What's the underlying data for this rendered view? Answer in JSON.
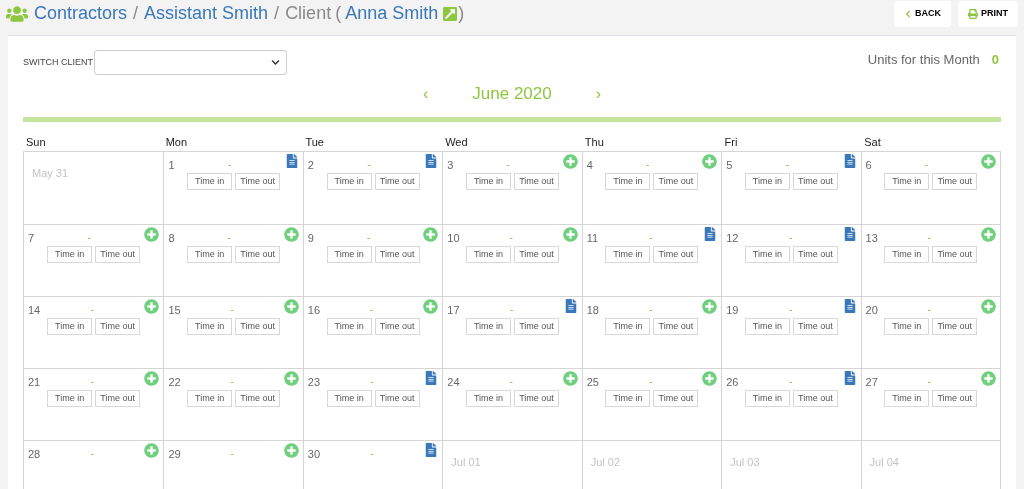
{
  "breadcrumb": [
    {
      "label": "Contractors",
      "kind": "link"
    },
    {
      "label": "/",
      "kind": "sep"
    },
    {
      "label": "Assistant Smith",
      "kind": "link"
    },
    {
      "label": "/",
      "kind": "sep"
    },
    {
      "label": "Client",
      "kind": "muted"
    },
    {
      "label": "(",
      "kind": "muted"
    },
    {
      "label": "Anna Smith",
      "kind": "link"
    },
    {
      "label": ")",
      "kind": "muted"
    }
  ],
  "actions": [
    {
      "label": "BACK",
      "kind": "back"
    },
    {
      "label": "PRINT",
      "kind": "print"
    }
  ],
  "switch_client": {
    "label": "SWITCH CLIENT"
  },
  "units": {
    "label": "Units for this Month",
    "value": "0"
  },
  "month": {
    "prev": "‹",
    "title": "June 2020",
    "next": "›"
  },
  "weekdays": [
    "Sun",
    "Mon",
    "Tue",
    "Wed",
    "Thu",
    "Fri",
    "Sat"
  ],
  "weeks": [
    [
      {
        "date": "May 31",
        "kind": "outside"
      },
      {
        "date": "1",
        "kind": "day_entry",
        "dash": "-",
        "fields": [
          {
            "placeholder": "Time in"
          },
          {
            "placeholder": "Time out"
          }
        ]
      },
      {
        "date": "2",
        "kind": "day_entry",
        "dash": "-",
        "fields": [
          {
            "placeholder": "Time in"
          },
          {
            "placeholder": "Time out"
          }
        ]
      },
      {
        "date": "3",
        "kind": "day_open",
        "dash": "-",
        "fields": [
          {
            "placeholder": "Time in"
          },
          {
            "placeholder": "Time out"
          }
        ]
      },
      {
        "date": "4",
        "kind": "day_open",
        "dash": "-",
        "fields": [
          {
            "placeholder": "Time in"
          },
          {
            "placeholder": "Time out"
          }
        ]
      },
      {
        "date": "5",
        "kind": "day_entry",
        "dash": "-",
        "fields": [
          {
            "placeholder": "Time in"
          },
          {
            "placeholder": "Time out"
          }
        ]
      },
      {
        "date": "6",
        "kind": "day_open",
        "dash": "-",
        "fields": [
          {
            "placeholder": "Time in"
          },
          {
            "placeholder": "Time out"
          }
        ]
      }
    ],
    [
      {
        "date": "7",
        "kind": "day_open",
        "dash": "-",
        "fields": [
          {
            "placeholder": "Time in"
          },
          {
            "placeholder": "Time out"
          }
        ]
      },
      {
        "date": "8",
        "kind": "day_open",
        "dash": "-",
        "fields": [
          {
            "placeholder": "Time in"
          },
          {
            "placeholder": "Time out"
          }
        ]
      },
      {
        "date": "9",
        "kind": "day_open",
        "dash": "-",
        "fields": [
          {
            "placeholder": "Time in"
          },
          {
            "placeholder": "Time out"
          }
        ]
      },
      {
        "date": "10",
        "kind": "day_open",
        "dash": "-",
        "fields": [
          {
            "placeholder": "Time in"
          },
          {
            "placeholder": "Time out"
          }
        ]
      },
      {
        "date": "11",
        "kind": "day_entry",
        "dash": "-",
        "fields": [
          {
            "placeholder": "Time in"
          },
          {
            "placeholder": "Time out"
          }
        ]
      },
      {
        "date": "12",
        "kind": "day_entry",
        "dash": "-",
        "fields": [
          {
            "placeholder": "Time in"
          },
          {
            "placeholder": "Time out"
          }
        ]
      },
      {
        "date": "13",
        "kind": "day_open",
        "dash": "-",
        "fields": [
          {
            "placeholder": "Time in"
          },
          {
            "placeholder": "Time out"
          }
        ]
      }
    ],
    [
      {
        "date": "14",
        "kind": "day_open",
        "dash": "-",
        "fields": [
          {
            "placeholder": "Time in"
          },
          {
            "placeholder": "Time out"
          }
        ]
      },
      {
        "date": "15",
        "kind": "day_open",
        "dash": "-",
        "fields": [
          {
            "placeholder": "Time in"
          },
          {
            "placeholder": "Time out"
          }
        ]
      },
      {
        "date": "16",
        "kind": "day_open",
        "dash": "-",
        "fields": [
          {
            "placeholder": "Time in"
          },
          {
            "placeholder": "Time out"
          }
        ]
      },
      {
        "date": "17",
        "kind": "day_entry",
        "dash": "-",
        "fields": [
          {
            "placeholder": "Time in"
          },
          {
            "placeholder": "Time out"
          }
        ]
      },
      {
        "date": "18",
        "kind": "day_open",
        "dash": "-",
        "fields": [
          {
            "placeholder": "Time in"
          },
          {
            "placeholder": "Time out"
          }
        ]
      },
      {
        "date": "19",
        "kind": "day_entry",
        "dash": "-",
        "fields": [
          {
            "placeholder": "Time in"
          },
          {
            "placeholder": "Time out"
          }
        ]
      },
      {
        "date": "20",
        "kind": "day_open",
        "dash": "-",
        "fields": [
          {
            "placeholder": "Time in"
          },
          {
            "placeholder": "Time out"
          }
        ]
      }
    ],
    [
      {
        "date": "21",
        "kind": "day_open",
        "dash": "-",
        "fields": [
          {
            "placeholder": "Time in"
          },
          {
            "placeholder": "Time out"
          }
        ]
      },
      {
        "date": "22",
        "kind": "day_open",
        "dash": "-",
        "fields": [
          {
            "placeholder": "Time in"
          },
          {
            "placeholder": "Time out"
          }
        ]
      },
      {
        "date": "23",
        "kind": "day_entry",
        "dash": "-",
        "fields": [
          {
            "placeholder": "Time in"
          },
          {
            "placeholder": "Time out"
          }
        ]
      },
      {
        "date": "24",
        "kind": "day_open",
        "dash": "-",
        "fields": [
          {
            "placeholder": "Time in"
          },
          {
            "placeholder": "Time out"
          }
        ]
      },
      {
        "date": "25",
        "kind": "day_open",
        "dash": "-",
        "fields": [
          {
            "placeholder": "Time in"
          },
          {
            "placeholder": "Time out"
          }
        ]
      },
      {
        "date": "26",
        "kind": "day_entry",
        "dash": "-",
        "fields": [
          {
            "placeholder": "Time in"
          },
          {
            "placeholder": "Time out"
          }
        ]
      },
      {
        "date": "27",
        "kind": "day_open",
        "dash": "-",
        "fields": [
          {
            "placeholder": "Time in"
          },
          {
            "placeholder": "Time out"
          }
        ]
      }
    ],
    [
      {
        "date": "28",
        "kind": "day_open",
        "dash": "-"
      },
      {
        "date": "29",
        "kind": "day_open",
        "dash": "-"
      },
      {
        "date": "30",
        "kind": "day_entry",
        "dash": "-"
      },
      {
        "date": "Jul 01",
        "kind": "outside"
      },
      {
        "date": "Jul 02",
        "kind": "outside"
      },
      {
        "date": "Jul 03",
        "kind": "outside"
      },
      {
        "date": "Jul 04",
        "kind": "outside"
      }
    ]
  ]
}
